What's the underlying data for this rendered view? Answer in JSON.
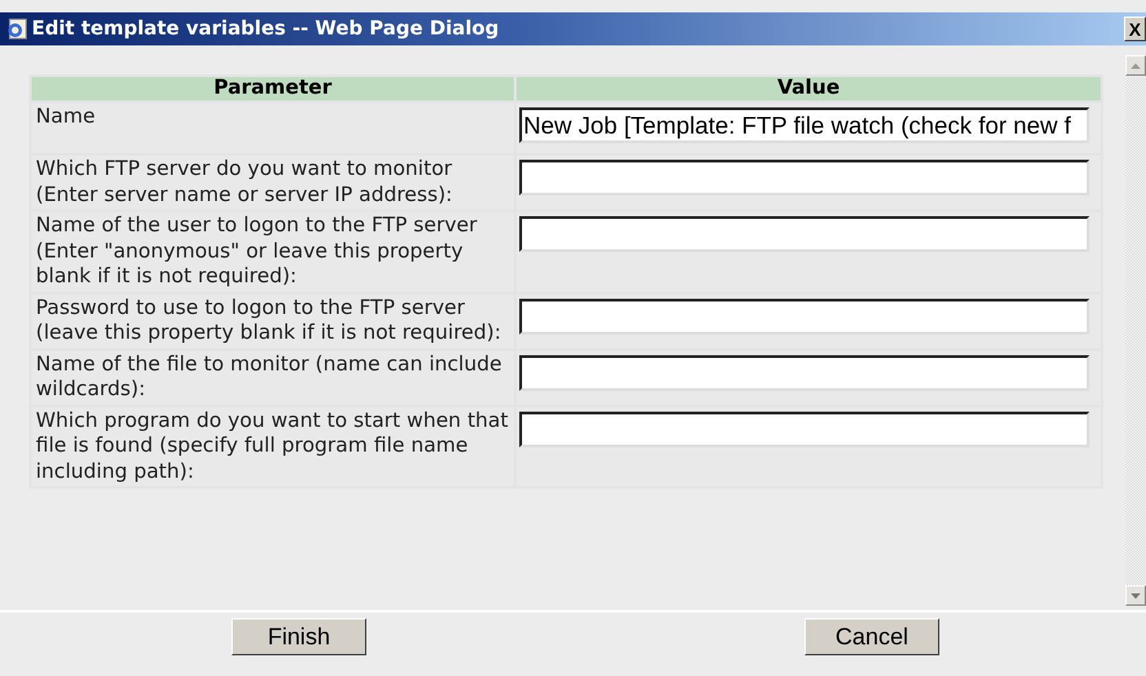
{
  "window": {
    "title": "Edit template variables -- Web Page Dialog",
    "close": "X"
  },
  "table": {
    "columns": [
      "Parameter",
      "Value"
    ],
    "rows": [
      {
        "parameter": "Name",
        "value": "New Job [Template: FTP file watch (check for new f"
      },
      {
        "parameter": "Which FTP server do you want to monitor (Enter server name or server IP address):",
        "value": ""
      },
      {
        "parameter": "Name of the user to logon to the FTP server (Enter \"anonymous\" or leave this property blank if it is not required):",
        "value": ""
      },
      {
        "parameter": "Password to use to logon to the FTP server (leave this property blank if it is not required):",
        "value": ""
      },
      {
        "parameter": "Name of the file to monitor (name can include wildcards):",
        "value": ""
      },
      {
        "parameter": "Which program do you want to start when that file is found (specify full program file name including path):",
        "value": ""
      }
    ]
  },
  "buttons": [
    "Finish",
    "Cancel"
  ]
}
